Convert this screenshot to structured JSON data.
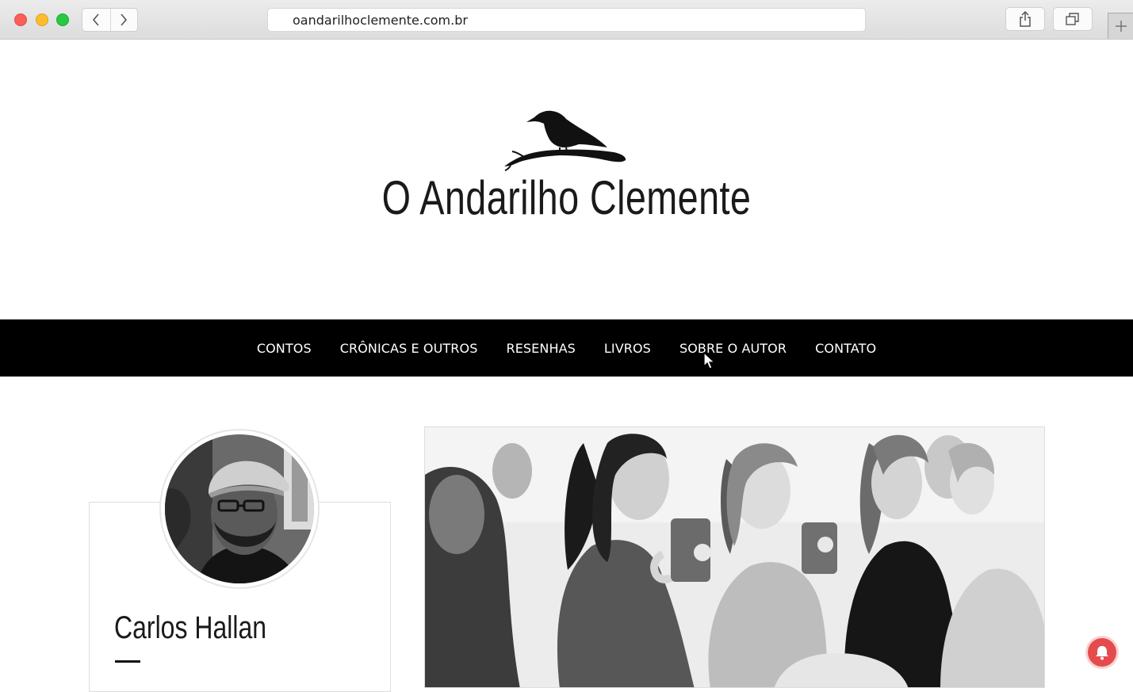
{
  "browser": {
    "url": "oandarilhoclemente.com.br",
    "back_icon": "chevron-left-icon",
    "forward_icon": "chevron-right-icon",
    "share_icon": "share-icon",
    "tabs_icon": "tabs-icon",
    "newtab_icon": "plus-icon"
  },
  "site": {
    "title": "O Andarilho Clemente",
    "logo_icon": "crow-on-branch-icon"
  },
  "nav": {
    "items": [
      {
        "label": "CONTOS"
      },
      {
        "label": "CRÔNICAS E OUTROS"
      },
      {
        "label": "RESENHAS"
      },
      {
        "label": "LIVROS"
      },
      {
        "label": "SOBRE O AUTOR"
      },
      {
        "label": "CONTATO"
      }
    ]
  },
  "author": {
    "name": "Carlos Hallan",
    "avatar_icon": "author-avatar"
  },
  "colors": {
    "nav_bg": "#000000",
    "nav_text": "#ffffff",
    "bell": "#e54b4d"
  },
  "notification": {
    "icon": "bell-icon"
  }
}
